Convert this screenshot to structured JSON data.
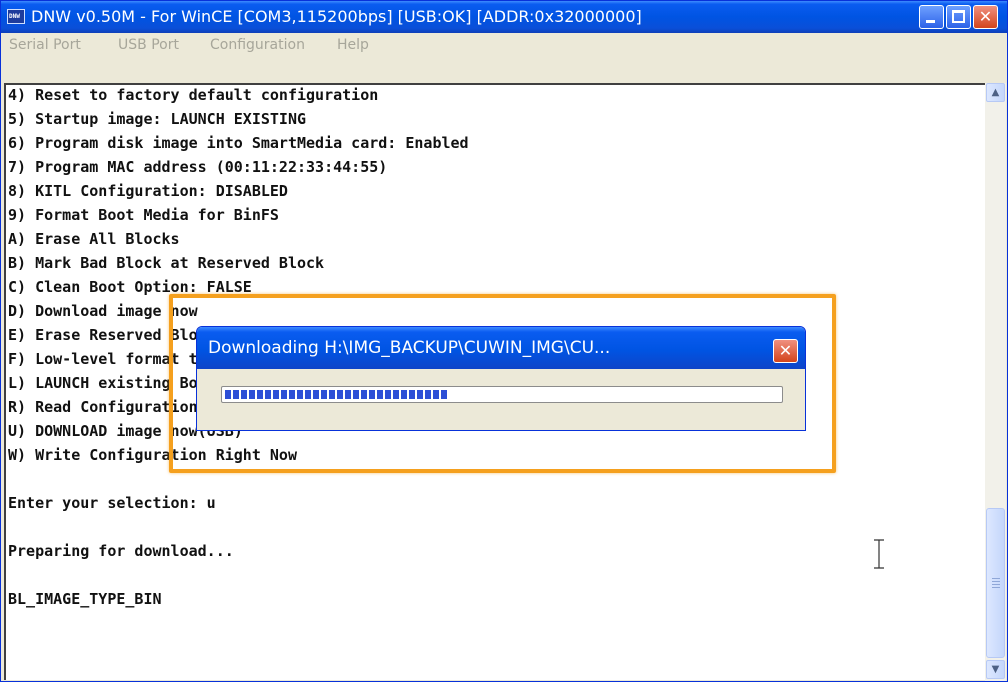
{
  "window": {
    "title": "DNW v0.50M - For WinCE   [COM3,115200bps] [USB:OK] [ADDR:0x32000000]",
    "icon_label": "DNW"
  },
  "menu": {
    "items": [
      "Serial Port",
      "USB Port",
      "Configuration",
      "Help"
    ]
  },
  "terminal": {
    "lines": [
      "4) Reset to factory default configuration",
      "5) Startup image: LAUNCH EXISTING",
      "6) Program disk image into SmartMedia card: Enabled",
      "7) Program MAC address (00:11:22:33:44:55)",
      "8) KITL Configuration: DISABLED",
      "9) Format Boot Media for BinFS",
      "A) Erase All Blocks",
      "B) Mark Bad Block at Reserved Block",
      "C) Clean Boot Option: FALSE",
      "D) Download image now",
      "E) Erase Reserved Block",
      "F) Low-level format the Smart Media card",
      "L) LAUNCH existing Boot Media image",
      "R) Read Configuration",
      "U) DOWNLOAD image now(USB)",
      "W) Write Configuration Right Now",
      "",
      "Enter your selection: u",
      "",
      "Preparing for download...",
      "",
      "BL_IMAGE_TYPE_BIN"
    ]
  },
  "dialog": {
    "title": "Downloading H:\\IMG_BACKUP\\CUWIN_IMG\\CU...",
    "progress_fraction": 0.4
  },
  "icons": {
    "minimize": "minimize-icon",
    "maximize": "maximize-icon",
    "close": "close-icon",
    "scroll_up": "scroll-up-icon",
    "scroll_down": "scroll-down-icon",
    "text_cursor": "text-cursor-icon"
  },
  "colors": {
    "titlebar": "#0054e3",
    "highlight": "#f5a01e",
    "progress": "#2d4fd6"
  }
}
